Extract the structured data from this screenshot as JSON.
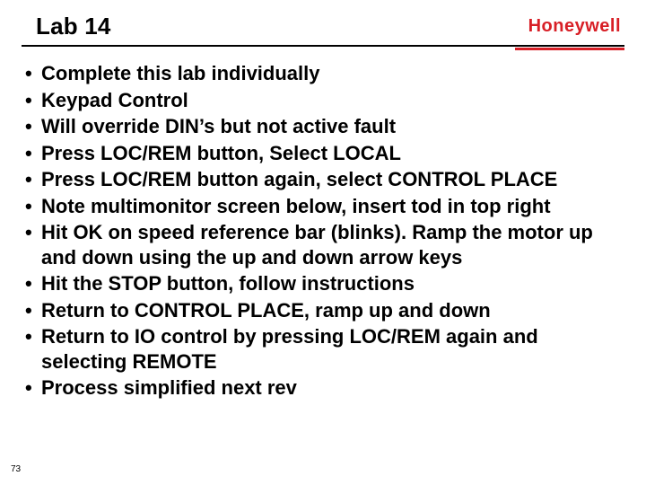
{
  "header": {
    "title": "Lab 14",
    "brand": "Honeywell",
    "brand_color": "#d81f26"
  },
  "bullets": [
    "Complete this lab individually",
    "Keypad Control",
    "Will override DIN’s but not active fault",
    "Press LOC/REM button, Select LOCAL",
    "Press LOC/REM button again, select CONTROL PLACE",
    "Note multimonitor screen below, insert tod in top right",
    "Hit OK on speed reference bar (blinks).  Ramp the motor up and down using the up and down arrow keys",
    "Hit the STOP button, follow instructions",
    "Return to CONTROL PLACE, ramp up and down",
    "Return to IO control by pressing LOC/REM again and selecting REMOTE",
    "Process simplified next rev"
  ],
  "page_number": "73"
}
